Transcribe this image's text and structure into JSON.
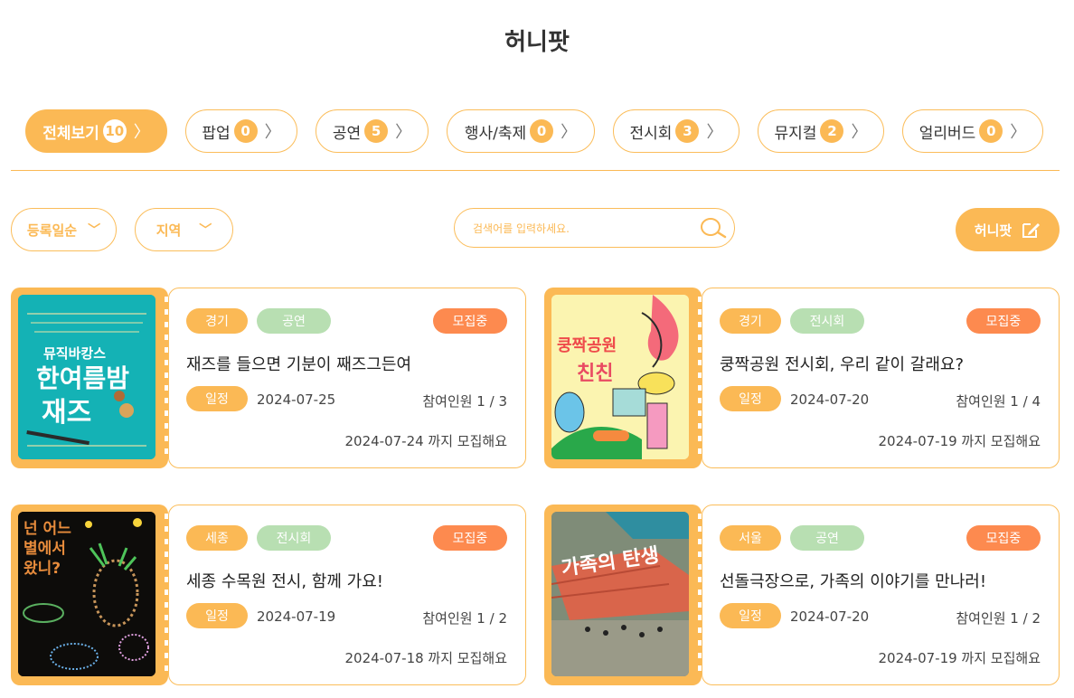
{
  "title": "허니팟",
  "categories": [
    {
      "label": "전체보기",
      "count": "10",
      "active": true
    },
    {
      "label": "팝업",
      "count": "0"
    },
    {
      "label": "공연",
      "count": "5"
    },
    {
      "label": "행사/축제",
      "count": "0"
    },
    {
      "label": "전시회",
      "count": "3"
    },
    {
      "label": "뮤지컬",
      "count": "2"
    },
    {
      "label": "얼리버드",
      "count": "0"
    }
  ],
  "filters": {
    "sort_label": "등록일순",
    "region_label": "지역",
    "search_placeholder": "검색어를 입력하세요.",
    "write_button": "허니팟"
  },
  "cards": [
    {
      "region": "경기",
      "type": "공연",
      "status": "모집중",
      "title": "재즈를 들으면 기분이 째즈그든여",
      "sched_label": "일정",
      "date": "2024-07-25",
      "participants": "참여인원 1 / 3",
      "deadline": "2024-07-24 까지 모집해요",
      "poster_text": "뮤직바캉스 한여름밤의 재즈"
    },
    {
      "region": "경기",
      "type": "전시회",
      "status": "모집중",
      "title": "쿵짝공원 전시회, 우리 같이 갈래요?",
      "sched_label": "일정",
      "date": "2024-07-20",
      "participants": "참여인원 1 / 4",
      "deadline": "2024-07-19 까지 모집해요",
      "poster_text": "쿵짝공원 친친"
    },
    {
      "region": "세종",
      "type": "전시회",
      "status": "모집중",
      "title": "세종 수목원 전시, 함께 가요!",
      "sched_label": "일정",
      "date": "2024-07-19",
      "participants": "참여인원 1 / 2",
      "deadline": "2024-07-18 까지 모집해요",
      "poster_text": "넌 어느 별에서 왔니?"
    },
    {
      "region": "서울",
      "type": "공연",
      "status": "모집중",
      "title": "선돌극장으로, 가족의 이야기를 만나러!",
      "sched_label": "일정",
      "date": "2024-07-20",
      "participants": "참여인원 1 / 2",
      "deadline": "2024-07-19 까지 모집해요",
      "poster_text": "가족의 탄생"
    }
  ]
}
